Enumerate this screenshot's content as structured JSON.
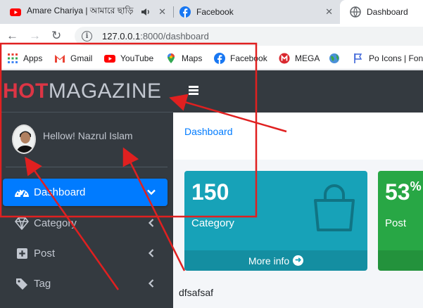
{
  "browser": {
    "tabs": [
      {
        "title": "Amare Chariya | আমারে ছাড়ি",
        "active": false
      },
      {
        "title": "Facebook",
        "active": false
      },
      {
        "title": "Dashboard",
        "active": true
      }
    ],
    "close_glyph": "✕",
    "address": {
      "host": "127.0.0.1",
      "path": ":8000/dashboard"
    },
    "bookmarks": [
      {
        "label": "Apps",
        "icon": "apps-grid-icon"
      },
      {
        "label": "Gmail",
        "icon": "gmail-icon"
      },
      {
        "label": "YouTube",
        "icon": "youtube-icon"
      },
      {
        "label": "Maps",
        "icon": "maps-icon"
      },
      {
        "label": "Facebook",
        "icon": "facebook-icon"
      },
      {
        "label": "MEGA",
        "icon": "mega-icon"
      },
      {
        "label": "",
        "icon": "globe-icon"
      },
      {
        "label": "Po Icons | Font",
        "icon": "flag-icon"
      }
    ]
  },
  "app": {
    "brand": {
      "hot": "HOT",
      "rest": "MAGAZINE"
    },
    "user": {
      "greeting": "Hellow! Nazrul Islam"
    },
    "sidebar": [
      {
        "label": "Dashboard",
        "icon": "tachometer-icon",
        "active": true
      },
      {
        "label": "Category",
        "icon": "gem-icon",
        "active": false
      },
      {
        "label": "Post",
        "icon": "plus-square-icon",
        "active": false
      },
      {
        "label": "Tag",
        "icon": "tag-icon",
        "active": false
      }
    ],
    "breadcrumb": "Dashboard",
    "boxes": [
      {
        "value": "150",
        "label": "Category",
        "footer": "More info"
      },
      {
        "value": "53",
        "suffix": "%",
        "label": "Post",
        "footer": ""
      }
    ],
    "bottom_text": "dfsafsaf"
  },
  "colors": {
    "sidebar_bg": "#343a40",
    "brand_red": "#dc3545",
    "primary": "#007bff",
    "info": "#17a2b8",
    "success": "#28a745",
    "annotation": "#e02020"
  }
}
